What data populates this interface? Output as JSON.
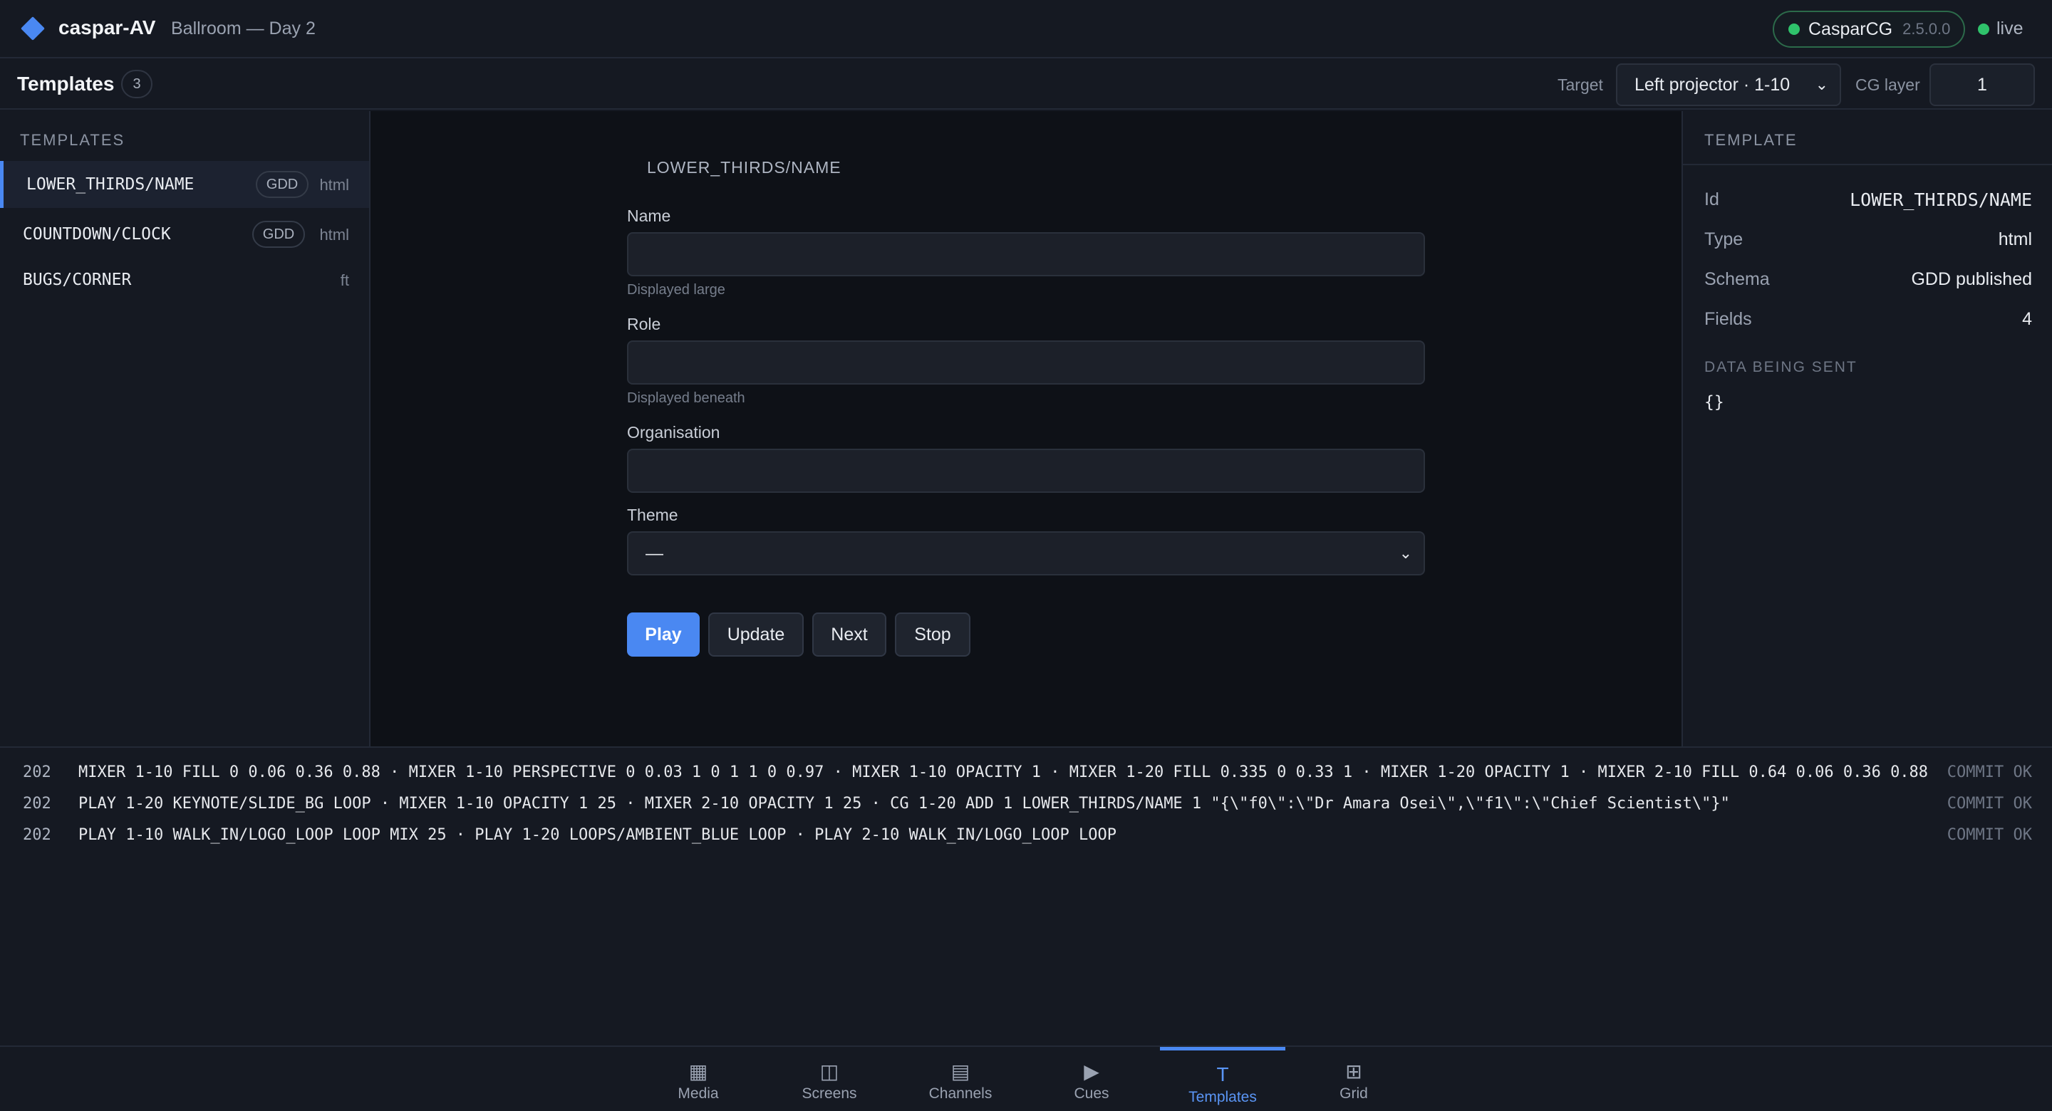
{
  "app": {
    "name": "caspar-AV",
    "project": "Ballroom — Day 2",
    "server_name": "CasparCG",
    "server_version": "2.5.0.0",
    "live_label": "live"
  },
  "toolbar": {
    "title": "Templates",
    "count": "3",
    "target_label": "Target",
    "target_value": "Left projector · 1-10",
    "layer_label": "CG layer",
    "layer_value": "1"
  },
  "templates": {
    "heading": "TEMPLATES",
    "items": [
      {
        "name": "LOWER_THIRDS/NAME",
        "badge": "GDD",
        "type": "html"
      },
      {
        "name": "COUNTDOWN/CLOCK",
        "badge": "GDD",
        "type": "html"
      },
      {
        "name": "BUGS/CORNER",
        "badge": "",
        "type": "ft"
      }
    ]
  },
  "form": {
    "title": "LOWER_THIRDS/NAME",
    "fields": [
      {
        "label": "Name",
        "value": "",
        "hint": "Displayed large"
      },
      {
        "label": "Role",
        "value": "",
        "hint": "Displayed beneath"
      },
      {
        "label": "Organisation",
        "value": "",
        "hint": ""
      },
      {
        "label": "Theme",
        "value": "—",
        "hint": ""
      }
    ],
    "buttons": {
      "play": "Play",
      "update": "Update",
      "next": "Next",
      "stop": "Stop"
    }
  },
  "details": {
    "heading": "TEMPLATE",
    "rows": [
      {
        "key": "Id",
        "value": "LOWER_THIRDS/NAME"
      },
      {
        "key": "Type",
        "value": "html"
      },
      {
        "key": "Schema",
        "value": "GDD published"
      },
      {
        "key": "Fields",
        "value": "4"
      }
    ],
    "data_heading": "DATA BEING SENT",
    "data_json": "{}"
  },
  "log": [
    {
      "code": "202",
      "text": "MIXER 1-10 FILL 0 0.06 0.36 0.88 · MIXER 1-10 PERSPECTIVE 0 0.03 1 0 1 1 0 0.97 · MIXER 1-10 OPACITY 1 · MIXER 1-20 FILL 0.335 0 0.33 1 · MIXER 1-20 OPACITY 1 · MIXER 2-10 FILL 0.64 0.06 0.36 0.88",
      "status": "COMMIT OK"
    },
    {
      "code": "202",
      "text": "PLAY 1-20 KEYNOTE/SLIDE_BG LOOP · MIXER 1-10 OPACITY 1 25 · MIXER 2-10 OPACITY 1 25 · CG 1-20 ADD 1 LOWER_THIRDS/NAME 1 \"{\\\"f0\\\":\\\"Dr Amara Osei\\\",\\\"f1\\\":\\\"Chief Scientist\\\"}\"",
      "status": "COMMIT OK"
    },
    {
      "code": "202",
      "text": "PLAY 1-10 WALK_IN/LOGO_LOOP LOOP MIX 25 · PLAY 1-20 LOOPS/AMBIENT_BLUE LOOP · PLAY 2-10 WALK_IN/LOGO_LOOP LOOP",
      "status": "COMMIT OK"
    }
  ],
  "nav": [
    {
      "label": "Media",
      "icon": "▦"
    },
    {
      "label": "Screens",
      "icon": "◫"
    },
    {
      "label": "Channels",
      "icon": "▤"
    },
    {
      "label": "Cues",
      "icon": "▶"
    },
    {
      "label": "Templates",
      "icon": "T"
    },
    {
      "label": "Grid",
      "icon": "⊞"
    }
  ],
  "colors": {
    "accent": "#4a88f2",
    "live": "#2fc26b",
    "background": "#151922"
  }
}
